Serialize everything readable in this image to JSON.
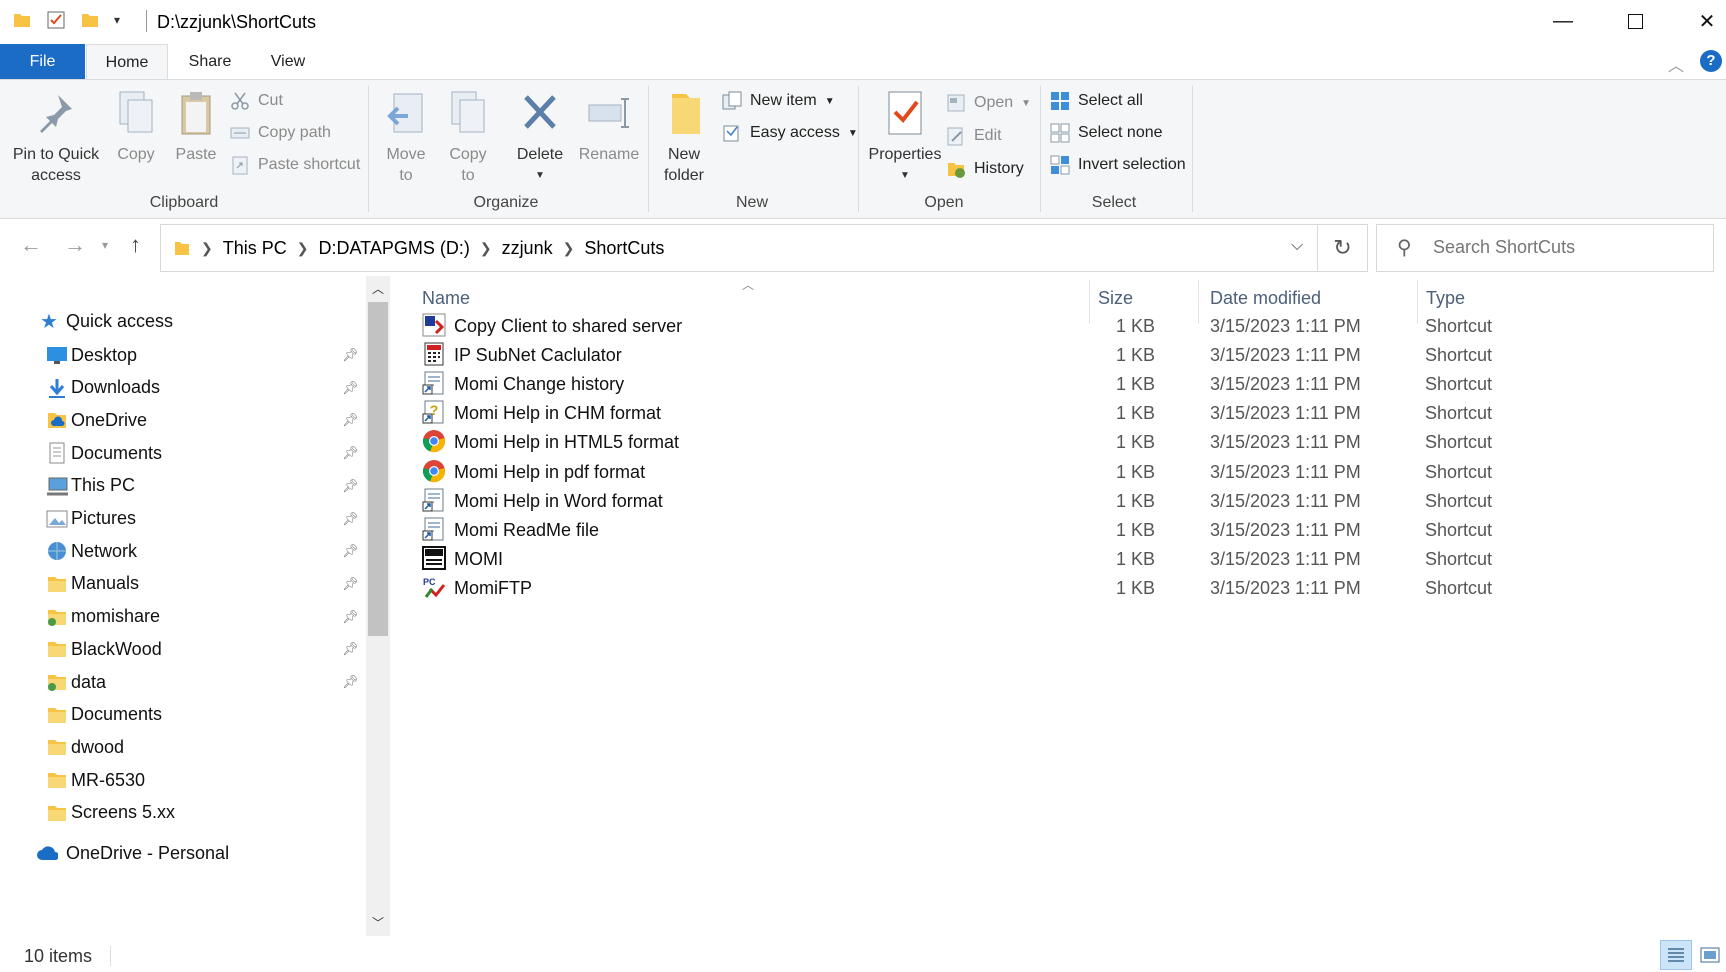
{
  "window": {
    "title": "D:\\zzjunk\\ShortCuts"
  },
  "tabs": {
    "file": "File",
    "home": "Home",
    "share": "Share",
    "view": "View"
  },
  "ribbon": {
    "clipboard": {
      "pin": "Pin to Quick access",
      "copy": "Copy",
      "paste": "Paste",
      "cut": "Cut",
      "copy_path": "Copy path",
      "paste_shortcut": "Paste shortcut",
      "label": "Clipboard"
    },
    "organize": {
      "move_to": "Move to",
      "copy_to": "Copy to",
      "delete": "Delete",
      "rename": "Rename",
      "label": "Organize"
    },
    "new": {
      "new_folder": "New folder",
      "new_item": "New item",
      "easy_access": "Easy access",
      "label": "New"
    },
    "open": {
      "properties": "Properties",
      "open": "Open",
      "edit": "Edit",
      "history": "History",
      "label": "Open"
    },
    "select": {
      "select_all": "Select all",
      "select_none": "Select none",
      "invert": "Invert selection",
      "label": "Select"
    }
  },
  "address": {
    "crumbs": [
      "This PC",
      "D:DATAPGMS (D:)",
      "zzjunk",
      "ShortCuts"
    ]
  },
  "search": {
    "placeholder": "Search ShortCuts"
  },
  "nav": {
    "quick_access": "Quick access",
    "items": [
      {
        "label": "Desktop",
        "icon": "desktop-icon"
      },
      {
        "label": "Downloads",
        "icon": "download-icon"
      },
      {
        "label": "OneDrive",
        "icon": "onedrive-folder-icon"
      },
      {
        "label": "Documents",
        "icon": "documents-icon"
      },
      {
        "label": "This PC",
        "icon": "this-pc-icon"
      },
      {
        "label": "Pictures",
        "icon": "pictures-icon"
      },
      {
        "label": "Network",
        "icon": "network-icon"
      },
      {
        "label": "Manuals",
        "icon": "folder-icon"
      },
      {
        "label": "momishare",
        "icon": "shared-folder-icon"
      },
      {
        "label": "BlackWood",
        "icon": "folder-icon"
      },
      {
        "label": "data",
        "icon": "shared-folder-icon"
      },
      {
        "label": "Documents",
        "icon": "folder-icon"
      },
      {
        "label": "dwood",
        "icon": "folder-icon"
      },
      {
        "label": "MR-6530",
        "icon": "folder-icon"
      },
      {
        "label": "Screens 5.xx",
        "icon": "folder-icon"
      }
    ],
    "onedrive_personal": "OneDrive - Personal"
  },
  "columns": {
    "name": "Name",
    "size": "Size",
    "date": "Date modified",
    "type": "Type"
  },
  "files": [
    {
      "name": "Copy Client to shared server",
      "size": "1 KB",
      "date": "3/15/2023 1:11 PM",
      "type": "Shortcut",
      "icon": "copy-client-icon"
    },
    {
      "name": "IP SubNet Caclulator",
      "size": "1 KB",
      "date": "3/15/2023 1:11 PM",
      "type": "Shortcut",
      "icon": "calculator-icon"
    },
    {
      "name": "Momi Change history",
      "size": "1 KB",
      "date": "3/15/2023 1:11 PM",
      "type": "Shortcut",
      "icon": "document-shortcut-icon"
    },
    {
      "name": "Momi Help in CHM format",
      "size": "1 KB",
      "date": "3/15/2023 1:11 PM",
      "type": "Shortcut",
      "icon": "chm-help-icon"
    },
    {
      "name": "Momi Help in HTML5 format",
      "size": "1 KB",
      "date": "3/15/2023 1:11 PM",
      "type": "Shortcut",
      "icon": "chrome-icon"
    },
    {
      "name": "Momi Help in pdf format",
      "size": "1 KB",
      "date": "3/15/2023 1:11 PM",
      "type": "Shortcut",
      "icon": "chrome-icon"
    },
    {
      "name": "Momi Help in Word format",
      "size": "1 KB",
      "date": "3/15/2023 1:11 PM",
      "type": "Shortcut",
      "icon": "document-shortcut-icon"
    },
    {
      "name": "Momi ReadMe file",
      "size": "1 KB",
      "date": "3/15/2023 1:11 PM",
      "type": "Shortcut",
      "icon": "document-shortcut-icon"
    },
    {
      "name": "MOMI",
      "size": "1 KB",
      "date": "3/15/2023 1:11 PM",
      "type": "Shortcut",
      "icon": "momi-app-icon"
    },
    {
      "name": "MomiFTP",
      "size": "1 KB",
      "date": "3/15/2023 1:11 PM",
      "type": "Shortcut",
      "icon": "ftp-icon"
    }
  ],
  "status": {
    "count": "10 items"
  },
  "colors": {
    "accent": "#1a6cc4",
    "folder": "#f6c342",
    "header_text": "#4c607a"
  }
}
